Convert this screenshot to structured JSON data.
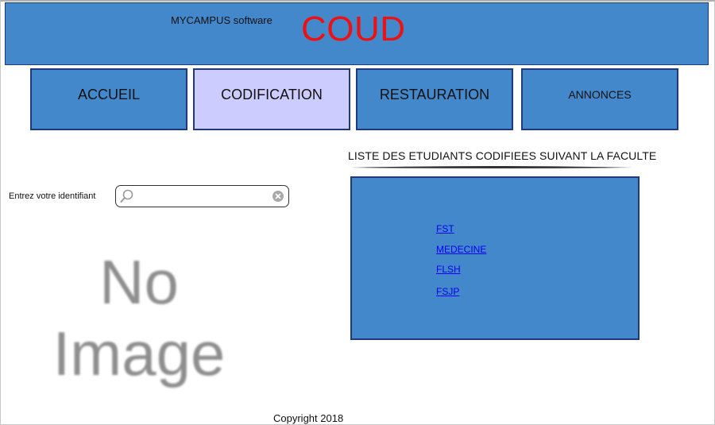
{
  "header": {
    "subtitle": "MYCAMPUS software",
    "logo": "COUD"
  },
  "nav": {
    "tabs": [
      {
        "label": "ACCUEIL"
      },
      {
        "label": "CODIFICATION"
      },
      {
        "label": "RESTAURATION"
      },
      {
        "label": "ANNONCES"
      }
    ],
    "active_tab": "CODIFICATION"
  },
  "login": {
    "label": "Entrez votre identifiant",
    "value": "",
    "placeholder": ""
  },
  "image_placeholder": {
    "line1": "No",
    "line2": "Image"
  },
  "faculty_list": {
    "title": "LISTE DES ETUDIANTS CODIFIEES SUIVANT LA FACULTE",
    "links": [
      {
        "label": "FST"
      },
      {
        "label": "MEDECINE"
      },
      {
        "label": "FLSH"
      },
      {
        "label": "FSJP"
      }
    ]
  },
  "footer": {
    "copyright": "Copyright 2018"
  },
  "colors": {
    "panel_blue": "#4488cc",
    "border_navy": "#1f3a7a",
    "active_tab": "#ccccff",
    "logo_red": "#ee1111",
    "link_blue": "#0000ee"
  },
  "icons": [
    "search-icon",
    "clear-icon"
  ]
}
